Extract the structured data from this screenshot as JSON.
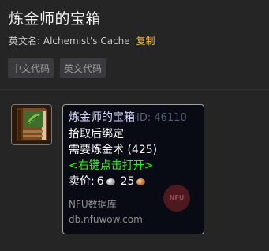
{
  "page": {
    "title": "炼金师的宝箱",
    "english_label": "英文名:",
    "english_name": "Alchemist's Cache",
    "copy_label": "复制"
  },
  "tabs": [
    {
      "label": "中文代码"
    },
    {
      "label": "英文代码"
    }
  ],
  "item": {
    "icon": "alchemist-book-icon",
    "name": "炼金师的宝箱",
    "id_text": "ID: 46110",
    "bind": "拾取后绑定",
    "requirement": "需要炼金术 (425)",
    "use_text": "<右键点击打开>",
    "price_label": "卖价:",
    "price_silver": "6",
    "price_copper": "25",
    "source_label": "NFU数据库",
    "source_domain": "db.nfuwow.com",
    "watermark_text": "NFU"
  },
  "colors": {
    "background": "#252526",
    "item_name": "#d8d8ff",
    "use_text": "#1eff00",
    "copy_link": "#f0b52c"
  }
}
